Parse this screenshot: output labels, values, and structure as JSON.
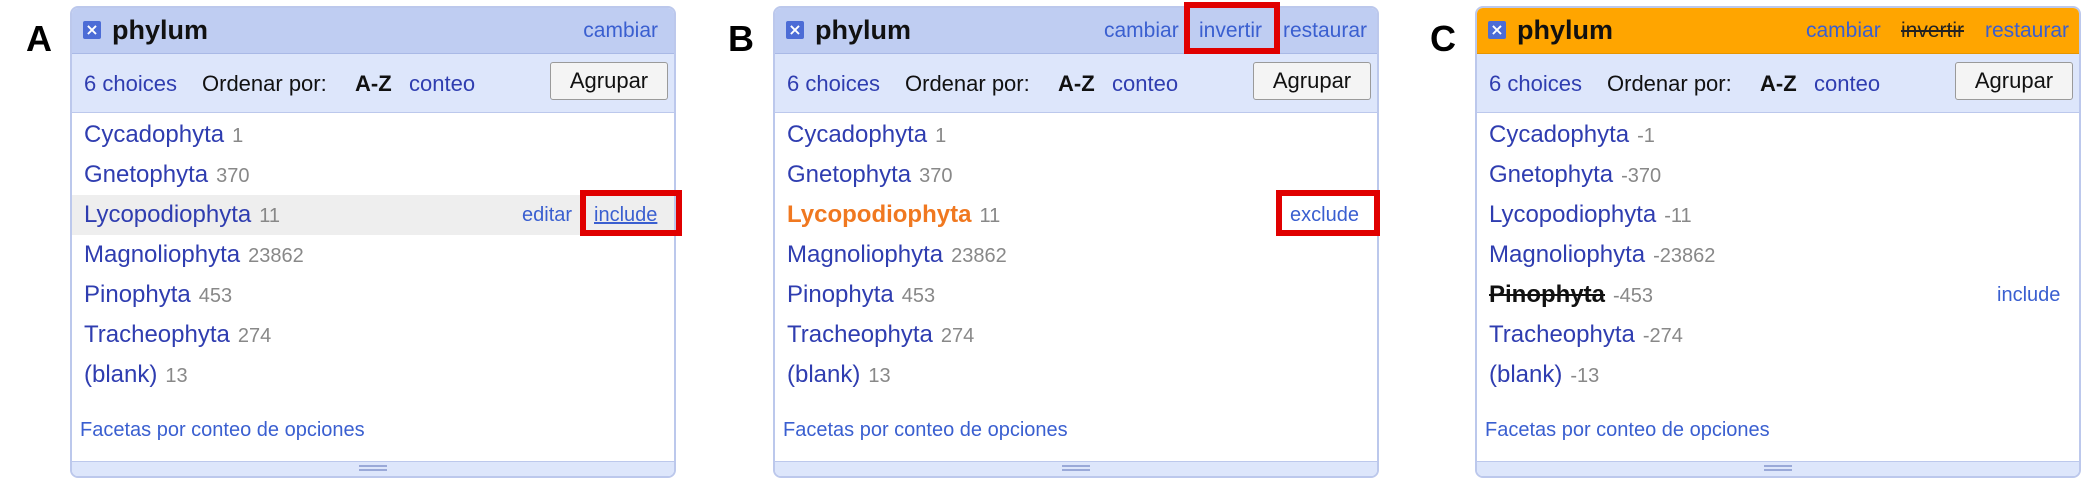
{
  "letters": [
    "A",
    "B",
    "C"
  ],
  "facet_title": "phylum",
  "header_links": {
    "change": "cambiar",
    "invert": "invertir",
    "reset": "restaurar"
  },
  "controls": {
    "choices": "6 choices",
    "sort_label": "Ordenar por:",
    "sort_az": "A-Z",
    "sort_count": "conteo",
    "group_button": "Agrupar"
  },
  "footer": "Facetas por conteo de opciones",
  "panelA": {
    "rows": [
      {
        "name": "Cycadophyta",
        "count": "1"
      },
      {
        "name": "Gnetophyta",
        "count": "370"
      },
      {
        "name": "Lycopodiophyta",
        "count": "11"
      },
      {
        "name": "Magnoliophyta",
        "count": "23862"
      },
      {
        "name": "Pinophyta",
        "count": "453"
      },
      {
        "name": "Tracheophyta",
        "count": "274"
      },
      {
        "name": "(blank)",
        "count": "13"
      }
    ],
    "edit_label": "editar",
    "include_label": "include"
  },
  "panelB": {
    "rows": [
      {
        "name": "Cycadophyta",
        "count": "1"
      },
      {
        "name": "Gnetophyta",
        "count": "370"
      },
      {
        "name": "Lycopodiophyta",
        "count": "11"
      },
      {
        "name": "Magnoliophyta",
        "count": "23862"
      },
      {
        "name": "Pinophyta",
        "count": "453"
      },
      {
        "name": "Tracheophyta",
        "count": "274"
      },
      {
        "name": "(blank)",
        "count": "13"
      }
    ],
    "exclude_label": "exclude"
  },
  "panelC": {
    "rows": [
      {
        "name": "Cycadophyta",
        "count": "-1"
      },
      {
        "name": "Gnetophyta",
        "count": "-370"
      },
      {
        "name": "Lycopodiophyta",
        "count": "-11"
      },
      {
        "name": "Magnoliophyta",
        "count": "-23862"
      },
      {
        "name": "Pinophyta",
        "count": "-453"
      },
      {
        "name": "Tracheophyta",
        "count": "-274"
      },
      {
        "name": "(blank)",
        "count": "-13"
      }
    ],
    "include_label": "include"
  },
  "colors": {
    "highlight": "#e00000",
    "header_blue": "#bfcdf2",
    "header_orange": "#ffa500",
    "selected_orange": "#f07820"
  }
}
